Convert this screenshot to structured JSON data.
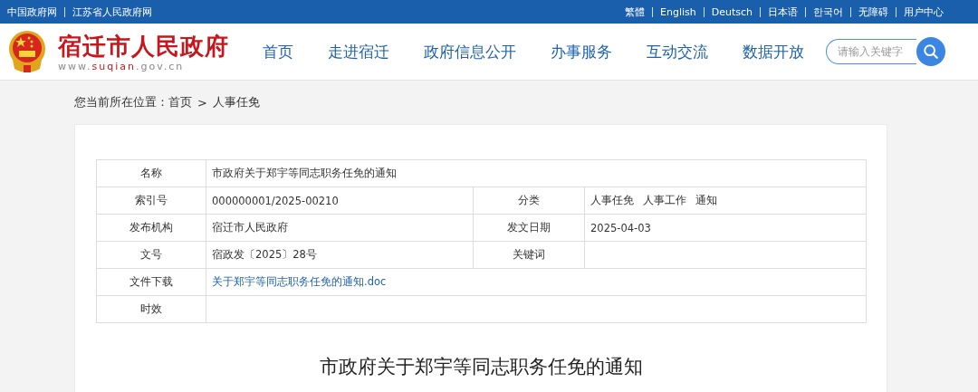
{
  "top_bar": {
    "left_links": [
      "中国政府网",
      "江苏省人民政府网"
    ],
    "right_links": [
      "繁體",
      "English",
      "Deutsch",
      "日本语",
      "한국어",
      "无障碍",
      "用户中心"
    ]
  },
  "header": {
    "site_name": "宿迁市人民政府",
    "site_url_parts": [
      "www.",
      "suqian",
      ".gov.cn"
    ],
    "nav": [
      {
        "label": "首页",
        "selected": false
      },
      {
        "label": "走进宿迁",
        "selected": false
      },
      {
        "label": "政府信息公开",
        "selected": false
      },
      {
        "label": "办事服务",
        "selected": false
      },
      {
        "label": "互动交流",
        "selected": false
      },
      {
        "label": "数据开放",
        "selected": false
      }
    ],
    "search": {
      "placeholder": "请输入关键字"
    }
  },
  "breadcrumb": {
    "prefix": "您当前所在位置：",
    "items": [
      "首页",
      "人事任免"
    ],
    "separator": ">"
  },
  "info_table": {
    "rows": [
      {
        "fields": [
          {
            "label": "名称",
            "value": "市政府关于郑宇等同志职务任免的通知"
          }
        ]
      },
      {
        "fields": [
          {
            "label": "索引号",
            "value": "000000001/2025-00210"
          },
          {
            "label": "分类",
            "tags": [
              "人事任免",
              "人事工作",
              "通知"
            ]
          }
        ]
      },
      {
        "fields": [
          {
            "label": "发布机构",
            "value": "宿迁市人民政府"
          },
          {
            "label": "发文日期",
            "value": "2025-04-03"
          }
        ]
      },
      {
        "fields": [
          {
            "label": "文号",
            "value": "宿政发〔2025〕28号"
          },
          {
            "label": "关键词"
          }
        ]
      },
      {
        "fields": [
          {
            "label": "文件下载",
            "value": "关于郑宇等同志职务任免的通知.doc",
            "kind": "link"
          }
        ]
      },
      {
        "fields": [
          {
            "label": "时效"
          }
        ]
      }
    ]
  },
  "article": {
    "title": "市政府关于郑宇等同志职务任免的通知"
  }
}
